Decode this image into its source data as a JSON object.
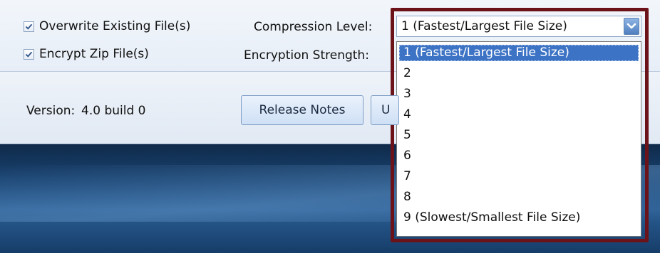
{
  "options": {
    "overwrite": {
      "label": "Overwrite Existing File(s)",
      "checked": true
    },
    "encrypt": {
      "label": "Encrypt Zip File(s)",
      "checked": true
    },
    "compression_label": "Compression Level:",
    "encryption_label": "Encryption Strength:",
    "compression_value": "1 (Fastest/Largest File Size)",
    "compression_options": [
      "1 (Fastest/Largest File Size)",
      "2",
      "3",
      "4",
      "5",
      "6",
      "7",
      "8",
      "9 (Slowest/Smallest File Size)"
    ],
    "selected_index": 0
  },
  "footer": {
    "version_label": "Version:",
    "version_value": "4.0 build 0",
    "release_notes_label": "Release Notes",
    "next_button_label": "U"
  },
  "colors": {
    "highlight_frame": "#6b1318",
    "selection": "#3d73c5"
  }
}
